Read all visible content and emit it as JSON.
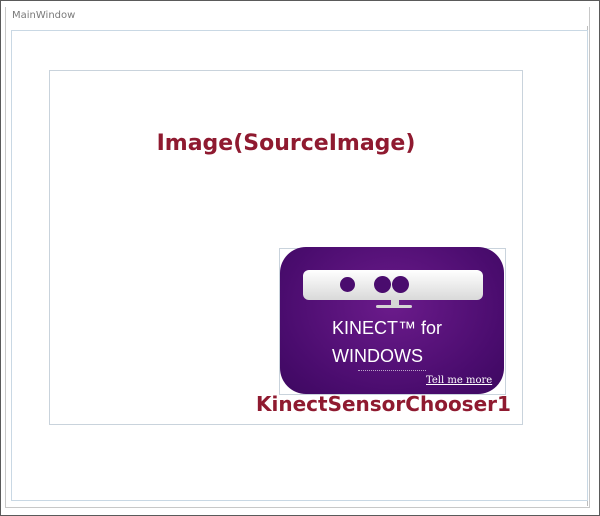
{
  "window": {
    "title": "MainWindow"
  },
  "image": {
    "label": "Image(SourceImage)"
  },
  "kinect_chooser": {
    "line1": "KINECT™ for",
    "line2": "WINDOWS",
    "link": "Tell me more",
    "label": "KinectSensorChooser1",
    "badge_color": "#4a0c6e"
  },
  "colors": {
    "label_text": "#8f1a30"
  }
}
